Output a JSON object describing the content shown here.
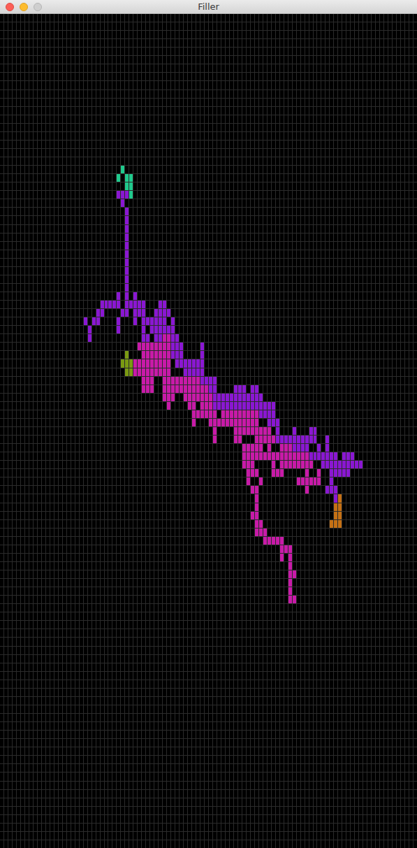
{
  "window": {
    "title": "Filler"
  },
  "board": {
    "width": 100,
    "height": 99,
    "players": [
      {
        "code": "P",
        "name": "purple",
        "color": "#8a17d2"
      },
      {
        "code": "M",
        "name": "magenta",
        "color": "#c81aa8"
      },
      {
        "code": "T",
        "name": "teal",
        "color": "#1fc98c"
      },
      {
        "code": "G",
        "name": "olive",
        "color": "#7a9a12"
      },
      {
        "code": "R",
        "name": "orange",
        "color": "#c47014"
      }
    ],
    "runs": [
      [
        18,
        29,
        29,
        "T"
      ],
      [
        19,
        28,
        28,
        "T"
      ],
      [
        19,
        30,
        31,
        "T"
      ],
      [
        20,
        30,
        31,
        "T"
      ],
      [
        21,
        28,
        30,
        "P"
      ],
      [
        21,
        31,
        31,
        "T"
      ],
      [
        22,
        29,
        29,
        "P"
      ],
      [
        23,
        30,
        30,
        "P"
      ],
      [
        24,
        30,
        30,
        "P"
      ],
      [
        25,
        30,
        30,
        "P"
      ],
      [
        26,
        30,
        30,
        "P"
      ],
      [
        27,
        30,
        30,
        "P"
      ],
      [
        28,
        30,
        30,
        "P"
      ],
      [
        29,
        30,
        30,
        "P"
      ],
      [
        30,
        30,
        30,
        "P"
      ],
      [
        31,
        30,
        30,
        "P"
      ],
      [
        32,
        30,
        30,
        "P"
      ],
      [
        33,
        28,
        28,
        "P"
      ],
      [
        33,
        30,
        30,
        "P"
      ],
      [
        33,
        32,
        32,
        "P"
      ],
      [
        34,
        24,
        28,
        "P"
      ],
      [
        34,
        30,
        34,
        "P"
      ],
      [
        34,
        38,
        39,
        "P"
      ],
      [
        35,
        23,
        24,
        "P"
      ],
      [
        35,
        29,
        30,
        "P"
      ],
      [
        35,
        32,
        34,
        "P"
      ],
      [
        35,
        37,
        40,
        "P"
      ],
      [
        36,
        20,
        20,
        "P"
      ],
      [
        36,
        22,
        23,
        "P"
      ],
      [
        36,
        28,
        28,
        "P"
      ],
      [
        36,
        32,
        32,
        "P"
      ],
      [
        36,
        34,
        37,
        "P"
      ],
      [
        36,
        38,
        39,
        "P"
      ],
      [
        36,
        41,
        41,
        "P"
      ],
      [
        37,
        21,
        21,
        "P"
      ],
      [
        37,
        28,
        28,
        "P"
      ],
      [
        37,
        34,
        34,
        "P"
      ],
      [
        37,
        36,
        39,
        "P"
      ],
      [
        37,
        40,
        41,
        "P"
      ],
      [
        38,
        21,
        21,
        "P"
      ],
      [
        38,
        34,
        35,
        "P"
      ],
      [
        38,
        37,
        38,
        "P"
      ],
      [
        38,
        39,
        40,
        "M"
      ],
      [
        38,
        41,
        42,
        "P"
      ],
      [
        39,
        33,
        40,
        "M"
      ],
      [
        39,
        41,
        43,
        "P"
      ],
      [
        39,
        48,
        48,
        "P"
      ],
      [
        40,
        30,
        30,
        "G"
      ],
      [
        40,
        34,
        40,
        "M"
      ],
      [
        40,
        41,
        43,
        "P"
      ],
      [
        40,
        48,
        48,
        "P"
      ],
      [
        41,
        29,
        31,
        "G"
      ],
      [
        41,
        32,
        40,
        "M"
      ],
      [
        41,
        42,
        48,
        "P"
      ],
      [
        42,
        30,
        31,
        "G"
      ],
      [
        42,
        32,
        40,
        "M"
      ],
      [
        42,
        44,
        48,
        "P"
      ],
      [
        43,
        34,
        36,
        "M"
      ],
      [
        43,
        39,
        47,
        "M"
      ],
      [
        43,
        48,
        51,
        "P"
      ],
      [
        44,
        34,
        36,
        "M"
      ],
      [
        44,
        39,
        49,
        "M"
      ],
      [
        44,
        50,
        51,
        "P"
      ],
      [
        44,
        56,
        58,
        "P"
      ],
      [
        44,
        60,
        61,
        "P"
      ],
      [
        45,
        39,
        41,
        "M"
      ],
      [
        45,
        44,
        50,
        "M"
      ],
      [
        45,
        51,
        62,
        "P"
      ],
      [
        46,
        40,
        40,
        "M"
      ],
      [
        46,
        45,
        46,
        "M"
      ],
      [
        46,
        48,
        50,
        "M"
      ],
      [
        46,
        51,
        59,
        "P"
      ],
      [
        46,
        60,
        65,
        "P"
      ],
      [
        47,
        46,
        51,
        "M"
      ],
      [
        47,
        53,
        61,
        "M"
      ],
      [
        47,
        62,
        65,
        "P"
      ],
      [
        48,
        46,
        46,
        "M"
      ],
      [
        48,
        50,
        61,
        "M"
      ],
      [
        48,
        64,
        66,
        "P"
      ],
      [
        49,
        51,
        51,
        "M"
      ],
      [
        49,
        56,
        64,
        "M"
      ],
      [
        49,
        66,
        66,
        "P"
      ],
      [
        49,
        70,
        70,
        "P"
      ],
      [
        49,
        74,
        75,
        "P"
      ],
      [
        50,
        51,
        51,
        "M"
      ],
      [
        50,
        56,
        57,
        "M"
      ],
      [
        50,
        61,
        65,
        "M"
      ],
      [
        50,
        66,
        75,
        "P"
      ],
      [
        50,
        78,
        78,
        "P"
      ],
      [
        51,
        58,
        62,
        "M"
      ],
      [
        51,
        64,
        64,
        "M"
      ],
      [
        51,
        67,
        69,
        "M"
      ],
      [
        51,
        70,
        73,
        "P"
      ],
      [
        51,
        76,
        76,
        "P"
      ],
      [
        51,
        78,
        78,
        "P"
      ],
      [
        52,
        58,
        73,
        "M"
      ],
      [
        52,
        74,
        80,
        "P"
      ],
      [
        52,
        82,
        84,
        "P"
      ],
      [
        53,
        58,
        60,
        "M"
      ],
      [
        53,
        65,
        65,
        "M"
      ],
      [
        53,
        67,
        74,
        "M"
      ],
      [
        53,
        77,
        86,
        "P"
      ],
      [
        54,
        59,
        61,
        "M"
      ],
      [
        54,
        65,
        67,
        "M"
      ],
      [
        54,
        73,
        73,
        "M"
      ],
      [
        54,
        76,
        76,
        "M"
      ],
      [
        54,
        79,
        83,
        "P"
      ],
      [
        55,
        59,
        59,
        "M"
      ],
      [
        55,
        62,
        62,
        "M"
      ],
      [
        55,
        71,
        76,
        "M"
      ],
      [
        55,
        79,
        79,
        "P"
      ],
      [
        56,
        60,
        61,
        "M"
      ],
      [
        56,
        73,
        73,
        "M"
      ],
      [
        56,
        78,
        80,
        "P"
      ],
      [
        57,
        61,
        61,
        "M"
      ],
      [
        57,
        80,
        80,
        "P"
      ],
      [
        57,
        81,
        81,
        "R"
      ],
      [
        58,
        61,
        61,
        "M"
      ],
      [
        58,
        80,
        81,
        "R"
      ],
      [
        59,
        60,
        61,
        "M"
      ],
      [
        59,
        80,
        81,
        "R"
      ],
      [
        60,
        61,
        62,
        "M"
      ],
      [
        60,
        79,
        81,
        "R"
      ],
      [
        61,
        61,
        63,
        "M"
      ],
      [
        62,
        63,
        67,
        "M"
      ],
      [
        63,
        67,
        69,
        "M"
      ],
      [
        64,
        67,
        67,
        "M"
      ],
      [
        64,
        69,
        69,
        "M"
      ],
      [
        65,
        69,
        69,
        "M"
      ],
      [
        66,
        69,
        70,
        "M"
      ],
      [
        67,
        69,
        69,
        "M"
      ],
      [
        68,
        69,
        69,
        "M"
      ],
      [
        69,
        69,
        70,
        "M"
      ]
    ]
  }
}
